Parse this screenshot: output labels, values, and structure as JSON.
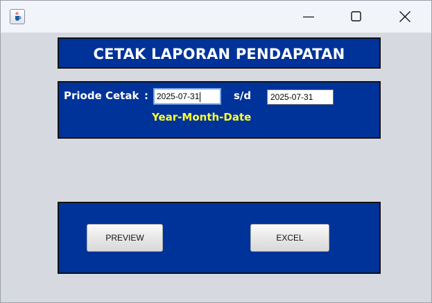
{
  "window": {
    "icon": "java-cup-icon",
    "controls": [
      "minimize-icon",
      "maximize-icon",
      "close-icon"
    ]
  },
  "header": {
    "title": "CETAK LAPORAN PENDAPATAN"
  },
  "form": {
    "periode_label": "Priode Cetak",
    "colon": ":",
    "date_from": "2025-07-31",
    "separator_label": "s/d",
    "date_to": "2025-07-31",
    "format_hint": "Year-Month-Date"
  },
  "actions": {
    "preview_label": "PREVIEW",
    "excel_label": "EXCEL"
  },
  "colors": {
    "panel_bg": "#003399",
    "panel_border": "#111111",
    "window_bg": "#d7d9e0",
    "hint_text": "#ffff33",
    "label_text": "#ffffff"
  }
}
